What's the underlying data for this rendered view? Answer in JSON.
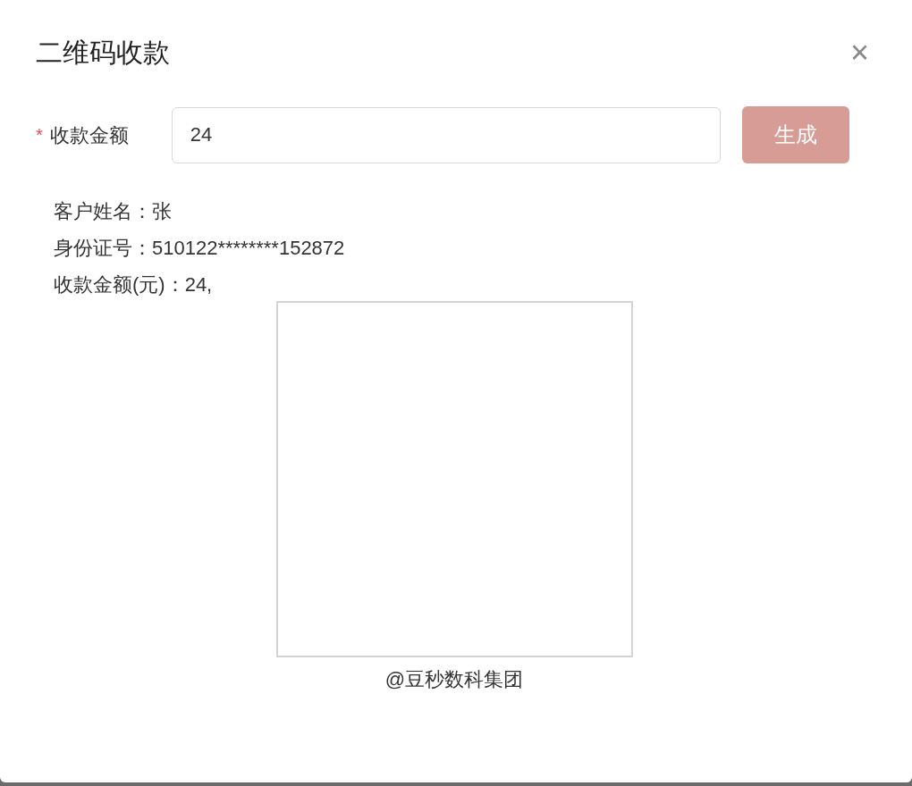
{
  "dialog": {
    "title": "二维码收款",
    "close": "×"
  },
  "form": {
    "required_mark": "*",
    "label": "收款金额",
    "value": "24",
    "button": "生成",
    "button_disabled": true
  },
  "info": [
    "客户姓名：张",
    "身份证号：510122********152872",
    "收款金额(元)：24,"
  ],
  "caption": "@豆秒数科集团"
}
